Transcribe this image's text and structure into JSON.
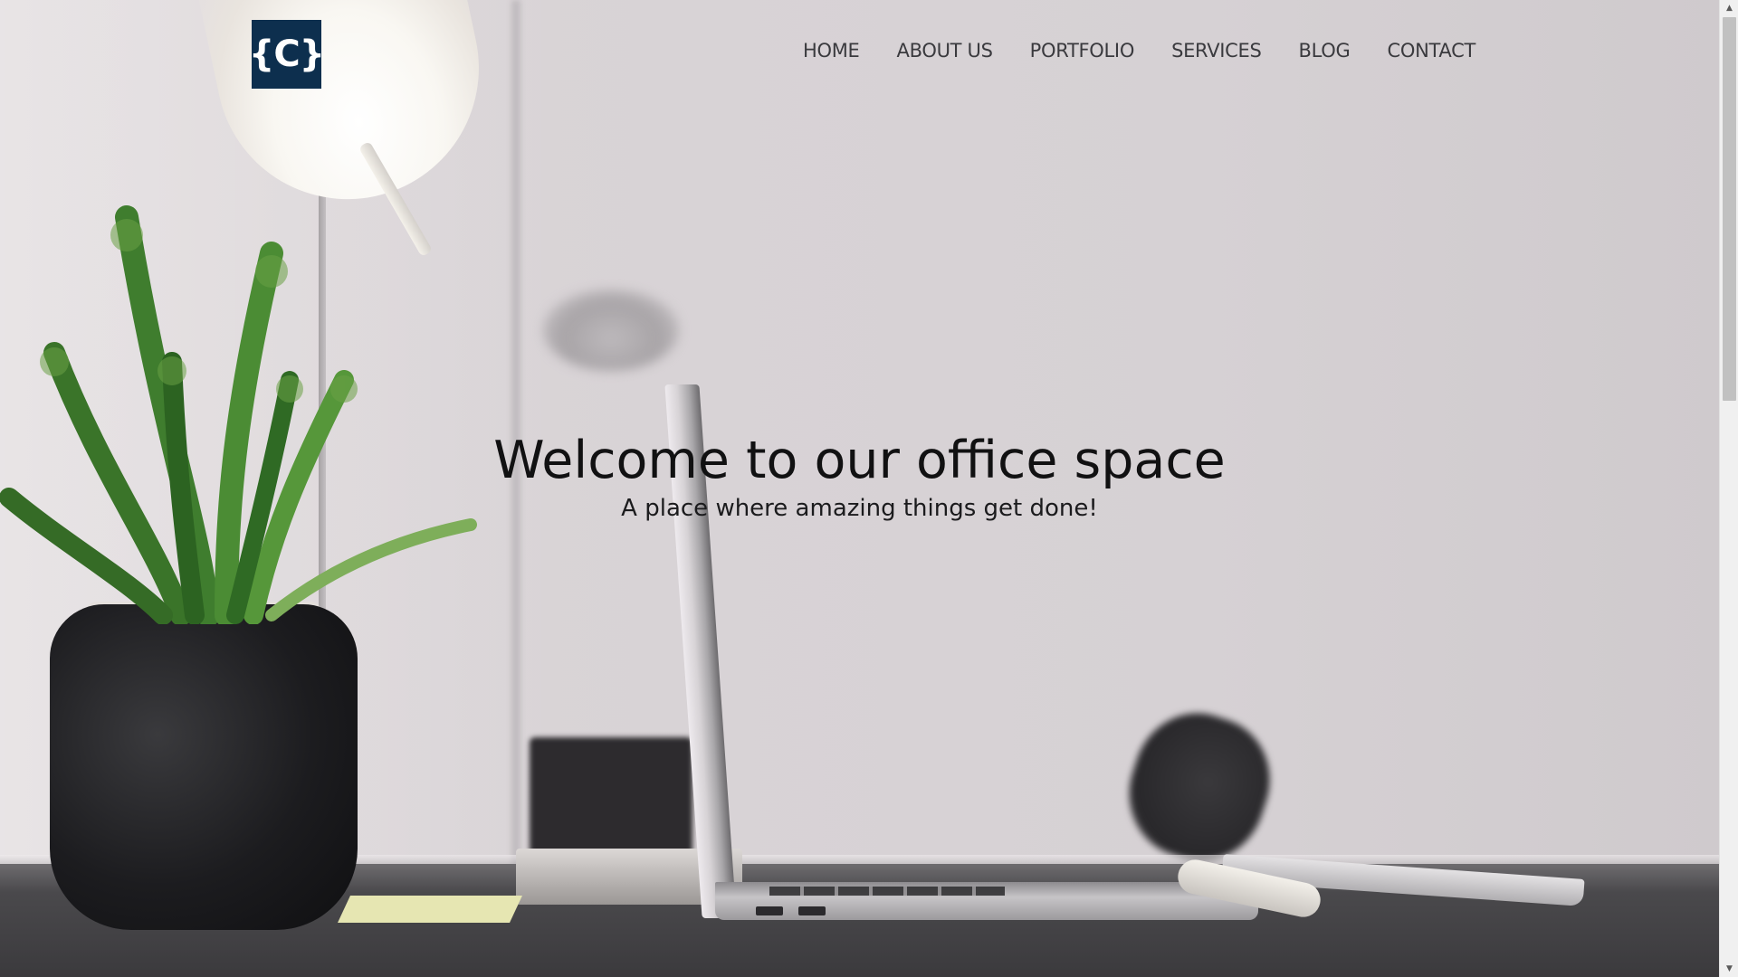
{
  "header": {
    "logo_text": "{C}",
    "nav": [
      {
        "label": "HOME"
      },
      {
        "label": "ABOUT US"
      },
      {
        "label": "PORTFOLIO"
      },
      {
        "label": "SERVICES"
      },
      {
        "label": "BLOG"
      },
      {
        "label": "CONTACT"
      }
    ]
  },
  "hero": {
    "title": "Welcome to our office space",
    "subtitle": "A place where amazing things get done!"
  },
  "scrollbar": {
    "up_icon": "chevron-up-icon",
    "down_icon": "chevron-down-icon"
  },
  "colors": {
    "logo_bg": "#0d2f4e",
    "nav_text": "#3a3a3e",
    "hero_text": "#111112"
  }
}
